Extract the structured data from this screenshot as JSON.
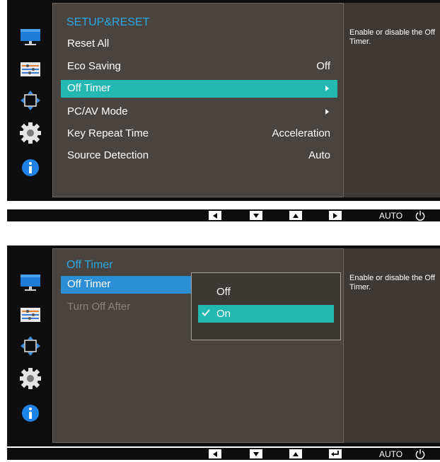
{
  "screen1": {
    "title": "SETUP&RESET",
    "items": [
      {
        "label": "Reset All",
        "value": ""
      },
      {
        "label": "Eco Saving",
        "value": "Off"
      },
      {
        "label": "Off Timer",
        "value": ""
      },
      {
        "label": "PC/AV Mode",
        "value": ""
      },
      {
        "label": "Key Repeat Time",
        "value": "Acceleration"
      },
      {
        "label": "Source Detection",
        "value": "Auto"
      }
    ],
    "description": "Enable or disable the Off Timer."
  },
  "screen2": {
    "title": "Off Timer",
    "items": [
      {
        "label": "Off Timer"
      },
      {
        "label": "Turn Off After"
      }
    ],
    "popup": {
      "options": [
        "Off",
        "On"
      ],
      "selected": "On"
    },
    "description": "Enable or disable the Off Timer."
  },
  "nav": {
    "auto_label": "AUTO"
  },
  "colors": {
    "highlight": "#24b8b2",
    "title_blue": "#2ca8e0",
    "panel": "#4a4440",
    "selected_blue": "#2c8fd6"
  },
  "icons": [
    "monitor-icon",
    "picture-settings-icon",
    "position-size-icon",
    "setup-gear-icon",
    "information-icon"
  ]
}
